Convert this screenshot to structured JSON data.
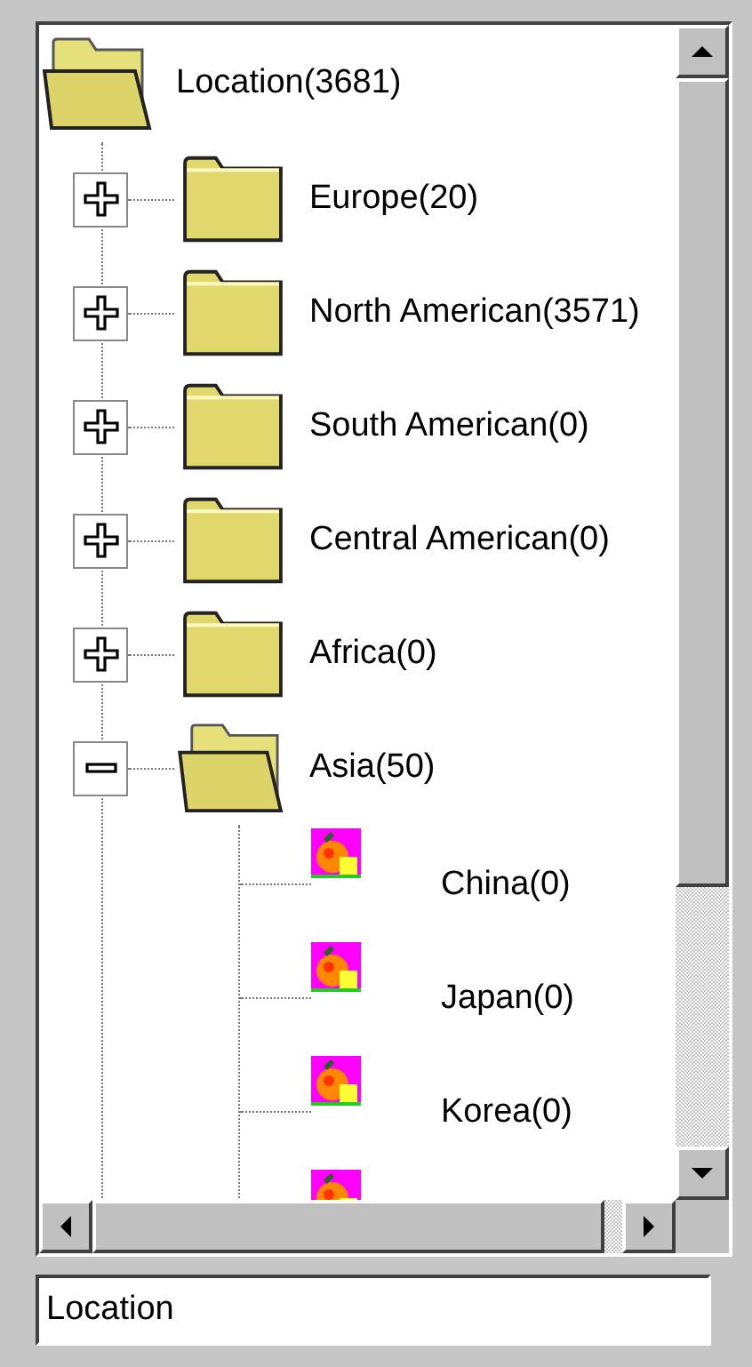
{
  "tree": {
    "label": "Location(3681)",
    "expanded": true,
    "children": [
      {
        "label": "Europe(20)",
        "expanded": false
      },
      {
        "label": "North American(3571)",
        "expanded": false
      },
      {
        "label": "South American(0)",
        "expanded": false
      },
      {
        "label": "Central American(0)",
        "expanded": false
      },
      {
        "label": "Africa(0)",
        "expanded": false
      },
      {
        "label": "Asia(50)",
        "expanded": true,
        "children": [
          {
            "kind": "item",
            "label": "China(0)"
          },
          {
            "kind": "item",
            "label": "Japan(0)"
          },
          {
            "kind": "item",
            "label": "Korea(0)"
          },
          {
            "kind": "item"
          }
        ]
      }
    ]
  },
  "location_field": {
    "value": "Location"
  }
}
